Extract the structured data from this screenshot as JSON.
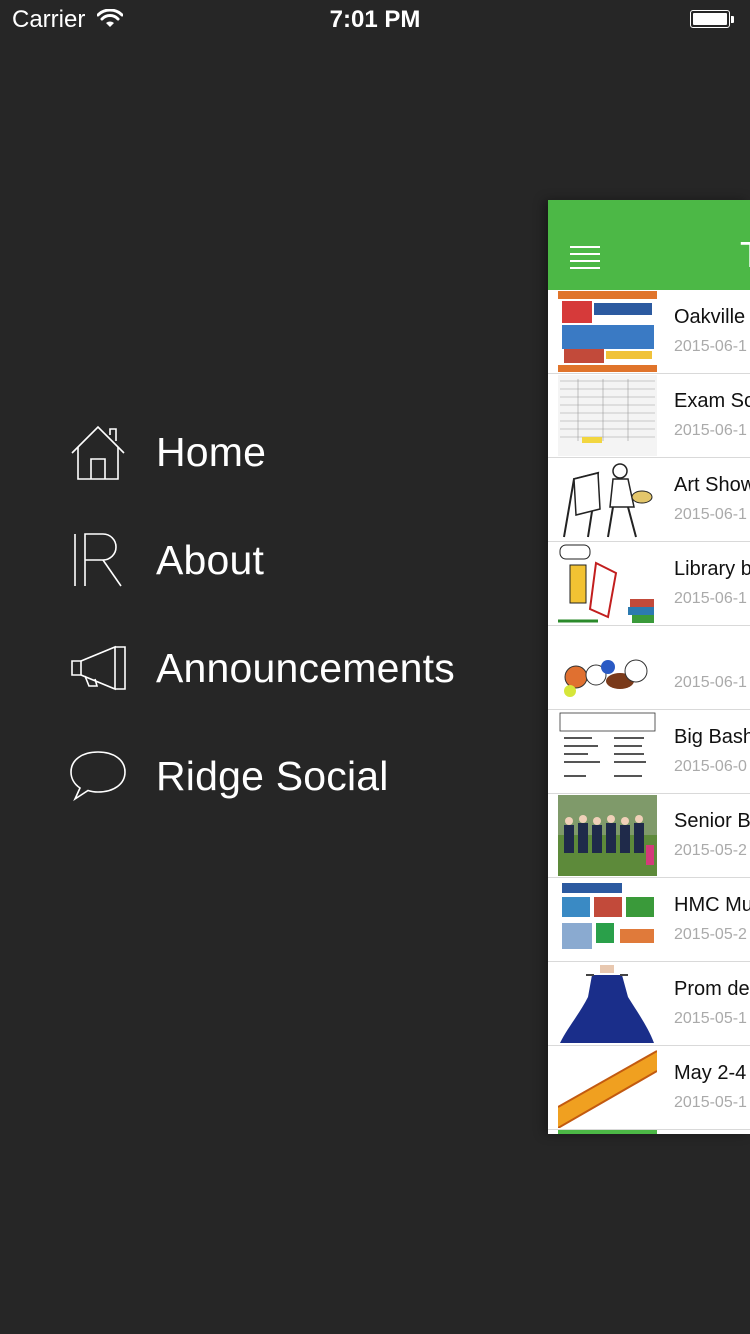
{
  "status_bar": {
    "carrier": "Carrier",
    "time": "7:01 PM"
  },
  "menu": {
    "items": [
      {
        "label": "Home",
        "icon": "home-icon"
      },
      {
        "label": "About",
        "icon": "logo-ir-icon"
      },
      {
        "label": "Announcements",
        "icon": "megaphone-icon"
      },
      {
        "label": "Ridge Social",
        "icon": "speech-bubble-icon"
      }
    ]
  },
  "panel": {
    "title": "T",
    "accent_color": "#4cb846",
    "rows": [
      {
        "title": "Oakville",
        "date": "2015-06-1",
        "thumb": "ribfest-poster"
      },
      {
        "title": "Exam Sc",
        "date": "2015-06-1",
        "thumb": "exam-schedule-table"
      },
      {
        "title": "Art Show",
        "date": "2015-06-1",
        "thumb": "painter-clipart"
      },
      {
        "title": "Library b",
        "date": "2015-06-1",
        "thumb": "library-books-clipart"
      },
      {
        "title": "",
        "date": "2015-06-1",
        "thumb": "sports-balls"
      },
      {
        "title": "Big Bash",
        "date": "2015-06-0",
        "thumb": "social-schedule"
      },
      {
        "title": "Senior B",
        "date": "2015-05-2",
        "thumb": "team-photo"
      },
      {
        "title": "HMC Mu",
        "date": "2015-05-2",
        "thumb": "hmc-poster"
      },
      {
        "title": "Prom de",
        "date": "2015-05-1",
        "thumb": "prom-dress"
      },
      {
        "title": "May 2-4",
        "date": "2015-05-1",
        "thumb": "may-weekend-text"
      }
    ]
  }
}
